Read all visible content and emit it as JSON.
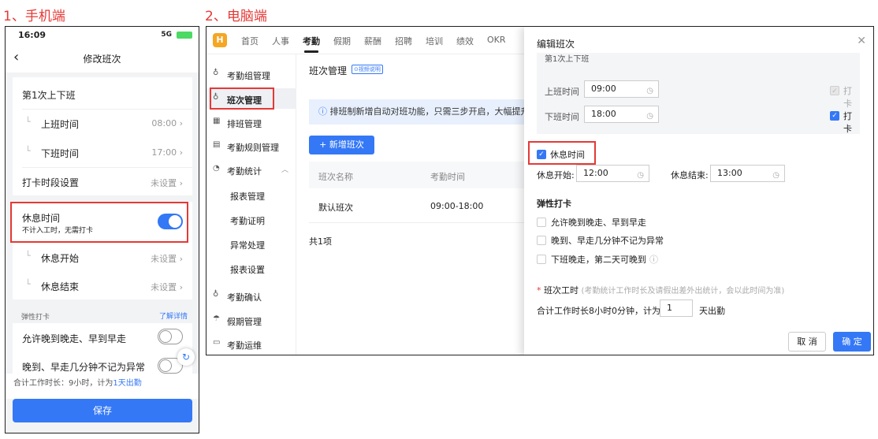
{
  "headings": {
    "mobile": "1、手机端",
    "desktop": "2、电脑端"
  },
  "mobile": {
    "status": {
      "time": "16:09",
      "network": "5G"
    },
    "nav": {
      "title": "修改班次"
    },
    "shift": {
      "title": "第1次上下班",
      "on_label": "上班时间",
      "on_value": "08:00",
      "off_label": "下班时间",
      "off_value": "17:00",
      "punch_label": "打卡时段设置",
      "punch_value": "未设置"
    },
    "rest": {
      "title": "休息时间",
      "desc": "不计入工时，无需打卡",
      "enabled": true,
      "start_label": "休息开始",
      "start_value": "未设置",
      "end_label": "休息结束",
      "end_value": "未设置"
    },
    "flex": {
      "section": "弹性打卡",
      "more": "了解详情",
      "item1": "允许晚到晚走、早到早走",
      "item2": "晚到、早走几分钟不记为异常"
    },
    "total": {
      "prefix": "合计工作时长：9小时，计为",
      "link": "1天出勤"
    },
    "save_label": "保存"
  },
  "desktop": {
    "nav": [
      "首页",
      "人事",
      "考勤",
      "假期",
      "薪酬",
      "招聘",
      "培训",
      "绩效",
      "OKR"
    ],
    "nav_active": "考勤",
    "logo": "H",
    "sidebar": {
      "items": [
        {
          "icon": "♁",
          "label": "考勤组管理"
        },
        {
          "icon": "♁",
          "label": "班次管理"
        },
        {
          "icon": "▦",
          "label": "排班管理"
        },
        {
          "icon": "▤",
          "label": "考勤规则管理"
        },
        {
          "icon": "◔",
          "label": "考勤统计"
        },
        {
          "icon": "",
          "label": "报表管理"
        },
        {
          "icon": "",
          "label": "考勤证明"
        },
        {
          "icon": "",
          "label": "异常处理"
        },
        {
          "icon": "",
          "label": "报表设置"
        },
        {
          "icon": "♁",
          "label": "考勤确认"
        },
        {
          "icon": "☂",
          "label": "假期管理"
        },
        {
          "icon": "▭",
          "label": "考勤运维"
        }
      ]
    },
    "main": {
      "title": "班次管理",
      "video_tag": "⊙视频说明",
      "info": "排班制新增自动对班功能，只需三步开启，大幅提升",
      "add_button": "+ 新增班次",
      "columns": [
        "班次名称",
        "考勤时间"
      ],
      "rows": [
        {
          "name": "默认班次",
          "time": "09:00-18:00"
        }
      ],
      "total": "共1项"
    },
    "modal": {
      "title": "编辑班次",
      "shift_title": "第1次上下班",
      "on_label": "上班时间",
      "on_value": "09:00",
      "on_punch": "打卡",
      "off_label": "下班时间",
      "off_value": "18:00",
      "off_punch": "打卡",
      "rest_label": "休息时间",
      "rest_start_label": "休息开始:",
      "rest_start_value": "12:00",
      "rest_end_label": "休息结束:",
      "rest_end_value": "13:00",
      "flex_title": "弹性打卡",
      "flex1": "允许晚到晚走、早到早走",
      "flex2": "晚到、早走几分钟不记为异常",
      "flex3": "下班晚走，第二天可晚到",
      "hours_label": "班次工时",
      "hours_hint": "(考勤统计工作时长及请假出差外出统计，会以此时间为准)",
      "hours_prefix": "合计工作时长8小时0分钟，计为",
      "hours_days": "1",
      "hours_suffix": "天出勤",
      "cancel": "取 消",
      "confirm": "确 定"
    }
  }
}
